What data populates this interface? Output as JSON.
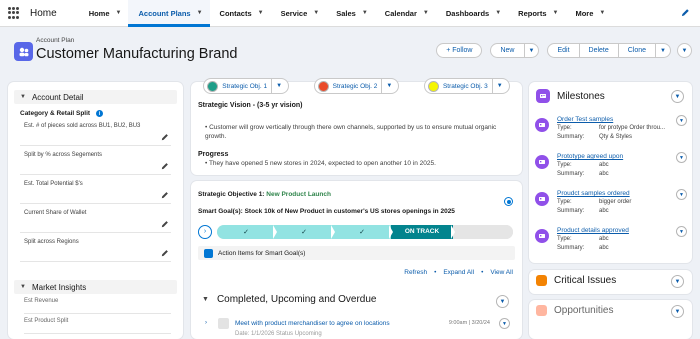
{
  "app": {
    "name": "Home"
  },
  "nav": {
    "tabs": [
      {
        "label": "Home"
      },
      {
        "label": "Account Plans"
      },
      {
        "label": "Contacts"
      },
      {
        "label": "Service"
      },
      {
        "label": "Sales"
      },
      {
        "label": "Calendar"
      },
      {
        "label": "Dashboards"
      },
      {
        "label": "Reports"
      },
      {
        "label": "More"
      }
    ]
  },
  "header": {
    "object_type": "Account Plan",
    "title": "Customer Manufacturing Brand",
    "follow_label": "+ Follow",
    "new_label": "New",
    "edit_label": "Edit",
    "delete_label": "Delete",
    "clone_label": "Clone"
  },
  "account_detail": {
    "title": "Account Detail",
    "subsection": "Category & Retail  Split",
    "info_glyph": "i",
    "fields": [
      {
        "label": "Est. # of pieces sold across  BU1, BU2, BU3"
      },
      {
        "label": "Split by % across Segements"
      },
      {
        "label": "Est. Total Potential $'s"
      },
      {
        "label": "Current Share of Wallet"
      },
      {
        "label": "Split across Regions"
      }
    ]
  },
  "market_insights": {
    "title": "Market Insights",
    "fields": [
      {
        "label": "Est Revenue"
      },
      {
        "label": "Est Product Split"
      }
    ]
  },
  "objectives": [
    {
      "label": "Strategic Obj. 1",
      "color": "#1f9e89"
    },
    {
      "label": "Strategic Obj. 2",
      "color": "#ea4b2a"
    },
    {
      "label": "Strategic Obj. 3",
      "color": "#f5f500"
    }
  ],
  "vision": {
    "title": "Strategic Vision - (3-5 yr vision)",
    "bullet": "• Customer will grow vertically through there own channels, supported by us to ensure mutual organic growth.",
    "progress_title": "Progress",
    "progress_bullet": "• They have opened 5 new stores in 2024, expected to open another 10 in 2025."
  },
  "objective_detail": {
    "prefix": "Strategic Objective 1: ",
    "name": "New Product  Launch",
    "goal": "Smart Goal(s): Stock 10k of New Product in customer's US stores openings in 2025",
    "path_toggle_glyph": "›",
    "stage_done_glyph": "✓",
    "stages_done": 3,
    "current_stage": "ON TRACK",
    "action_items_label": "Action Items for Smart Goal(s)",
    "links": [
      "Refresh",
      "Expand All",
      "View All"
    ]
  },
  "activity": {
    "section_title": "Completed, Upcoming and Overdue",
    "item_title": "Meet with product merchandiser to agree on  locations",
    "item_sub": "Date: 1/1/2026  Status Upcoming",
    "item_meta": "9:00am | 3/20/24"
  },
  "milestones": {
    "title": "Milestones",
    "items": [
      {
        "name": "Order Test samples",
        "type": "for protype Order throu...",
        "summary": "Qty & Styles"
      },
      {
        "name": "Prototype agreed upon",
        "type": "abc",
        "summary": "abc"
      },
      {
        "name": "Proudct samples ordered",
        "type": "bigger order",
        "summary": "abc"
      },
      {
        "name": "Product details approved",
        "type": "abc",
        "summary": "abc"
      }
    ],
    "type_label": "Type:",
    "summary_label": "Summary:"
  },
  "critical_issues": {
    "title": "Critical Issues",
    "color": "#f38303"
  },
  "opportunities": {
    "title": "Opportunities",
    "color": "#ff5d2d"
  },
  "icons": {
    "launcher": "app-launcher-icon",
    "edit": "pencil-icon",
    "chevron": "chevron-down-icon"
  }
}
